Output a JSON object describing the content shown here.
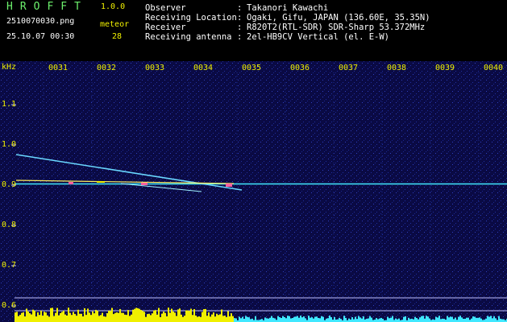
{
  "header": {
    "logo": "HROFFT",
    "version": "1.0.0",
    "filename": "2510070030.png",
    "datetime": "25.10.07 00:30",
    "meteor_label": "meteor",
    "meteor_count": "28"
  },
  "info": [
    {
      "label": "Observer",
      "value": "Takanori Kawachi"
    },
    {
      "label": "Receiving Location",
      "value": "Ogaki, Gifu, JAPAN (136.60E, 35.35N)"
    },
    {
      "label": "Receiver",
      "value": "R820T2(RTL-SDR) SDR-Sharp 53.372MHz"
    },
    {
      "label": "Receiving antenna",
      "value": "2el-HB9CV Vertical (el. E-W)"
    }
  ],
  "colors": {
    "background": "#000000",
    "plot_background": "#0a0a44",
    "label_yellow": "#f0f000",
    "header_green": "#6cf06c",
    "trace_cyan": "#40e8ff",
    "bottom_bars": "#f0f000"
  },
  "spectrogram": {
    "y_unit": "kHz",
    "y_ticks": [
      "1.1",
      "1.0",
      "0.9",
      "0.8",
      "0.7",
      "0.6"
    ],
    "x_ticks": [
      "0031",
      "0032",
      "0033",
      "0034",
      "0035",
      "0036",
      "0037",
      "0038",
      "0039",
      "0040"
    ],
    "carrier_khz": 0.903
  }
}
